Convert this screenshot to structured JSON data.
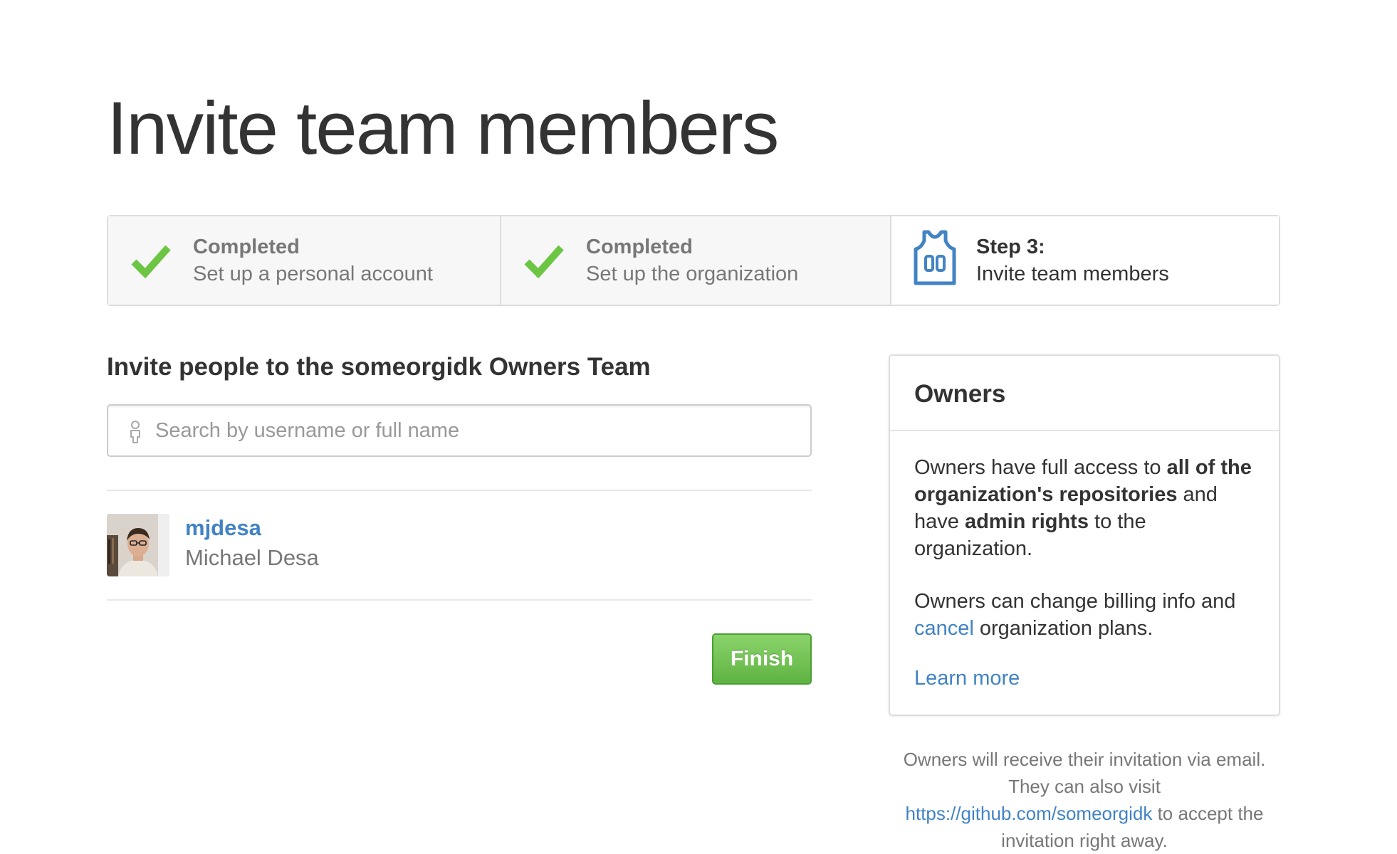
{
  "page": {
    "title": "Invite team members"
  },
  "steps": [
    {
      "status": "Completed",
      "description": "Set up a personal account",
      "icon": "checkmark-icon"
    },
    {
      "status": "Completed",
      "description": "Set up the organization",
      "icon": "checkmark-icon"
    },
    {
      "status": "Step 3:",
      "description": "Invite team members",
      "icon": "jersey-icon"
    }
  ],
  "invite": {
    "heading": "Invite people to the someorgidk Owners Team",
    "search_placeholder": "Search by username or full name",
    "members": [
      {
        "username": "mjdesa",
        "full_name": "Michael Desa"
      }
    ],
    "finish_label": "Finish"
  },
  "owners": {
    "title": "Owners",
    "para1": {
      "text1": "Owners have full access to ",
      "bold1": "all of the organization's repositories",
      "text2": " and have ",
      "bold2": "admin rights",
      "text3": " to the organization."
    },
    "para2": {
      "text1": "Owners can change billing info and ",
      "link": "cancel",
      "text2": " organization plans."
    },
    "learn_more": "Learn more"
  },
  "note": {
    "line1": "Owners will receive their invitation via email. They can also visit ",
    "link": "https://github.com/someorgidk",
    "line2": " to accept the invitation right away."
  },
  "colors": {
    "link": "#4183c4",
    "check": "#6cc644",
    "finish_button": "#5fb342",
    "muted_text": "#777777"
  }
}
